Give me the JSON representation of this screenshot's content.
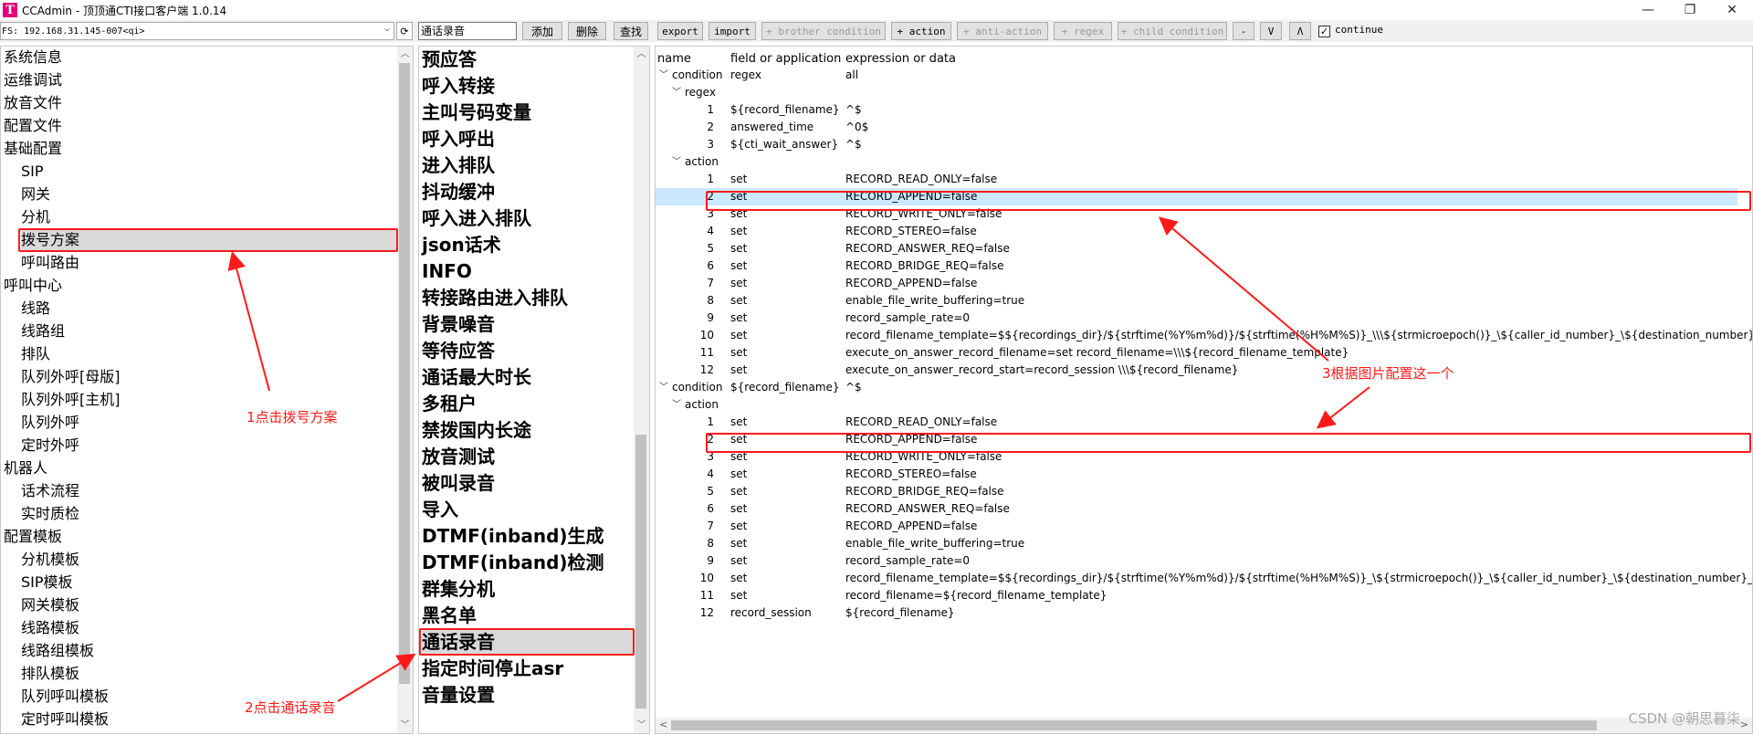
{
  "window": {
    "title": "CCAdmin - 顶顶通CTI接口客户端 1.0.14",
    "icon_letter": "T",
    "minimize": "—",
    "restore": "❐",
    "close": "✕"
  },
  "toolbar": {
    "fs_value": "FS: 192.168.31.145-007<qi>",
    "refresh": "⟳",
    "search_value": "通话录音",
    "add": "添加",
    "delete": "删除",
    "find": "查找",
    "export": "export",
    "import": "import",
    "brother_condition": "+ brother condition",
    "action": "+ action",
    "anti_action": "+ anti-action",
    "regex": "+ regex",
    "child_condition": "+ child condition",
    "minus": "-",
    "down": "V",
    "up": "Λ",
    "continue_checked": true,
    "continue_label": "continue"
  },
  "left_tree": [
    "系统信息",
    "运维调试",
    "放音文件",
    "配置文件",
    "基础配置",
    "SIP",
    "网关",
    "分机",
    "拨号方案",
    "呼叫路由",
    "呼叫中心",
    "线路",
    "线路组",
    "排队",
    "队列外呼[母版]",
    "队列外呼[主机]",
    "队列外呼",
    "定时外呼",
    "机器人",
    "话术流程",
    "实时质检",
    "配置模板",
    "分机模板",
    "SIP模板",
    "网关模板",
    "线路模板",
    "线路组模板",
    "排队模板",
    "队列呼叫模板",
    "定时呼叫模板"
  ],
  "dialplans": [
    "预应答",
    "呼入转接",
    "主叫号码变量",
    "呼入呼出",
    "进入排队",
    "抖动缓冲",
    "呼入进入排队",
    "json话术",
    "INFO",
    "转接路由进入排队",
    "背景噪音",
    "等待应答",
    "通话最大时长",
    "多租户",
    "禁拨国内长途",
    "放音测试",
    "被叫录音",
    "导入",
    "DTMF(inband)生成",
    "DTMF(inband)检测",
    "群集分机",
    "黑名单",
    "通话录音",
    "指定时间停止asr",
    "音量设置"
  ],
  "table": {
    "headers": {
      "name": "name",
      "field": "field or application",
      "expr": "expression or data"
    },
    "rows": [
      {
        "name": "condition",
        "field": "regex",
        "expr": "all"
      },
      {
        "name": "regex",
        "field": "",
        "expr": ""
      },
      {
        "name": "1",
        "field": "${record_filename}",
        "expr": "^$"
      },
      {
        "name": "2",
        "field": "answered_time",
        "expr": "^0$"
      },
      {
        "name": "3",
        "field": "${cti_wait_answer}",
        "expr": "^$"
      },
      {
        "name": "action",
        "field": "",
        "expr": ""
      },
      {
        "name": "1",
        "field": "set",
        "expr": "RECORD_READ_ONLY=false"
      },
      {
        "name": "2",
        "field": "set",
        "expr": "RECORD_APPEND=false"
      },
      {
        "name": "3",
        "field": "set",
        "expr": "RECORD_WRITE_ONLY=false"
      },
      {
        "name": "4",
        "field": "set",
        "expr": "RECORD_STEREO=false"
      },
      {
        "name": "5",
        "field": "set",
        "expr": "RECORD_ANSWER_REQ=false"
      },
      {
        "name": "6",
        "field": "set",
        "expr": "RECORD_BRIDGE_REQ=false"
      },
      {
        "name": "7",
        "field": "set",
        "expr": "RECORD_APPEND=false"
      },
      {
        "name": "8",
        "field": "set",
        "expr": "enable_file_write_buffering=true"
      },
      {
        "name": "9",
        "field": "set",
        "expr": "record_sample_rate=0"
      },
      {
        "name": "10",
        "field": "set",
        "expr": "record_filename_template=$${recordings_dir}/${strftime(%Y%m%d)}/${strftime(%H%M%S)}_\\\\\\${strmicroepoch()}_\\${caller_id_number}_\\${destination_number}_\\${uuid}.wav"
      },
      {
        "name": "11",
        "field": "set",
        "expr": "execute_on_answer_record_filename=set record_filename=\\\\\\${record_filename_template}"
      },
      {
        "name": "12",
        "field": "set",
        "expr": "execute_on_answer_record_start=record_session \\\\\\${record_filename}"
      },
      {
        "name": "condition",
        "field": "${record_filename}",
        "expr": "^$"
      },
      {
        "name": "action",
        "field": "",
        "expr": ""
      },
      {
        "name": "1",
        "field": "set",
        "expr": "RECORD_READ_ONLY=false"
      },
      {
        "name": "2",
        "field": "set",
        "expr": "RECORD_APPEND=false"
      },
      {
        "name": "3",
        "field": "set",
        "expr": "RECORD_WRITE_ONLY=false"
      },
      {
        "name": "4",
        "field": "set",
        "expr": "RECORD_STEREO=false"
      },
      {
        "name": "5",
        "field": "set",
        "expr": "RECORD_BRIDGE_REQ=false"
      },
      {
        "name": "6",
        "field": "set",
        "expr": "RECORD_ANSWER_REQ=false"
      },
      {
        "name": "7",
        "field": "set",
        "expr": "RECORD_APPEND=false"
      },
      {
        "name": "8",
        "field": "set",
        "expr": "enable_file_write_buffering=true"
      },
      {
        "name": "9",
        "field": "set",
        "expr": "record_sample_rate=0"
      },
      {
        "name": "10",
        "field": "set",
        "expr": "record_filename_template=$${recordings_dir}/${strftime(%Y%m%d)}/${strftime(%H%M%S)}_\\${strmicroepoch()}_\\${caller_id_number}_\\${destination_number}_\\${uuid}.wav"
      },
      {
        "name": "11",
        "field": "set",
        "expr": "record_filename=${record_filename_template}"
      },
      {
        "name": "12",
        "field": "record_session",
        "expr": "${record_filename}"
      }
    ]
  },
  "annotations": {
    "step1": "1点击拨号方案",
    "step2": "2点击通话录音",
    "step3": "3根据图片配置这一个",
    "color": "#ff1a1a"
  },
  "watermark": "CSDN @朝思暮柒"
}
